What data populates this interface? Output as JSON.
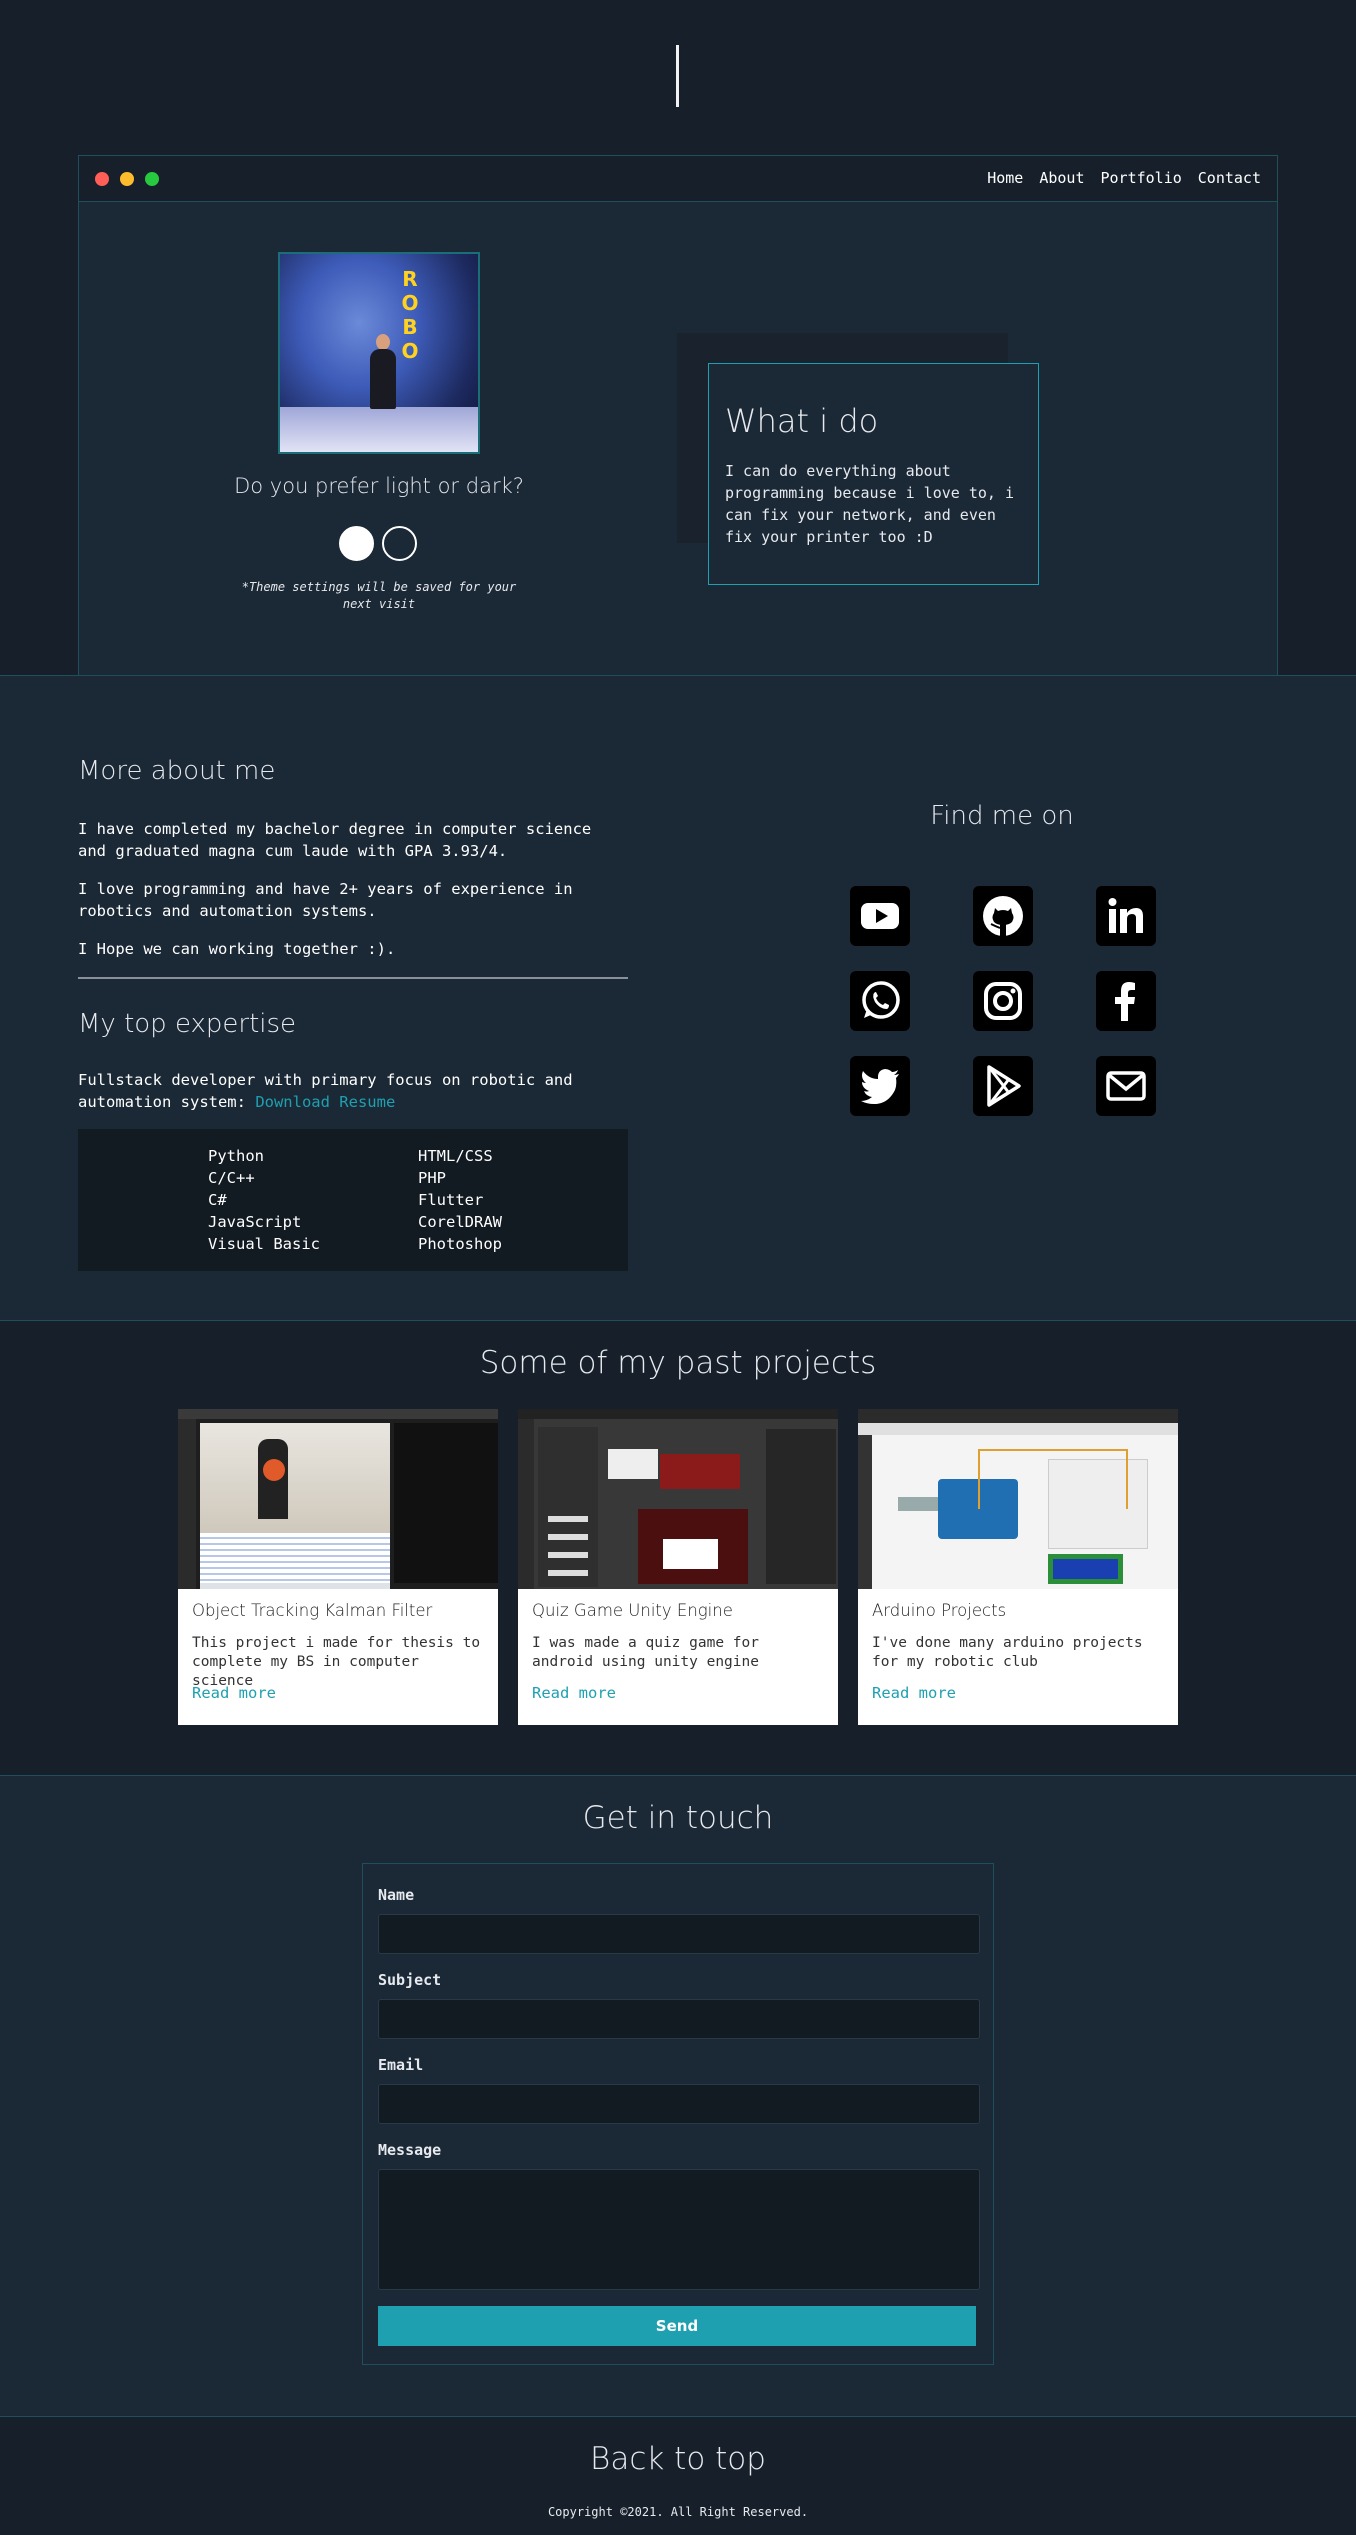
{
  "nav": {
    "items": [
      "Home",
      "About",
      "Portfolio",
      "Contact"
    ]
  },
  "hero": {
    "theme_question": "Do you prefer light or dark?",
    "theme_note": "*Theme settings will be saved for your next visit",
    "whatido_title": "What i do",
    "whatido_text": "I can do everything about programming because i love to, i can fix your network, and even fix your printer too :D",
    "banner_text": "ROBO"
  },
  "about": {
    "more_title": "More about me",
    "paragraphs": [
      "I have completed my bachelor degree in computer science and graduated magna cum laude with GPA 3.93/4.",
      "I love programming and have 2+ years of experience in robotics and automation systems.",
      "I Hope we can working together :)."
    ],
    "expertise_title": "My top expertise",
    "expertise_desc": "Fullstack developer with primary focus on robotic and automation system: ",
    "resume_link": "Download Resume",
    "skills_left": [
      "Python",
      "C/C++",
      "C#",
      "JavaScript",
      "Visual Basic"
    ],
    "skills_right": [
      "HTML/CSS",
      "PHP",
      "Flutter",
      "CorelDRAW",
      "Photoshop"
    ],
    "find_title": "Find me on",
    "social_icons": [
      "youtube-icon",
      "github-icon",
      "linkedin-icon",
      "whatsapp-icon",
      "instagram-icon",
      "facebook-icon",
      "twitter-icon",
      "google-play-icon",
      "mail-icon"
    ]
  },
  "projects": {
    "title": "Some of my past projects",
    "cards": [
      {
        "title": "Object Tracking Kalman Filter",
        "desc": "This project i made for thesis to complete my BS in computer science",
        "link": "Read more"
      },
      {
        "title": "Quiz Game Unity Engine",
        "desc": "I was made a quiz game for android using unity engine",
        "link": "Read more"
      },
      {
        "title": "Arduino Projects",
        "desc": "I've done many arduino projects for my robotic club",
        "link": "Read more"
      }
    ]
  },
  "contact": {
    "title": "Get in touch",
    "name_label": "Name",
    "subject_label": "Subject",
    "email_label": "Email",
    "message_label": "Message",
    "send_label": "Send"
  },
  "footer": {
    "back_to_top": "Back to top",
    "copyright": "Copyright ©2021. All Right Reserved."
  },
  "colors": {
    "accent": "#1fa0b0",
    "background": "#17202a",
    "panel": "#1b2836"
  }
}
